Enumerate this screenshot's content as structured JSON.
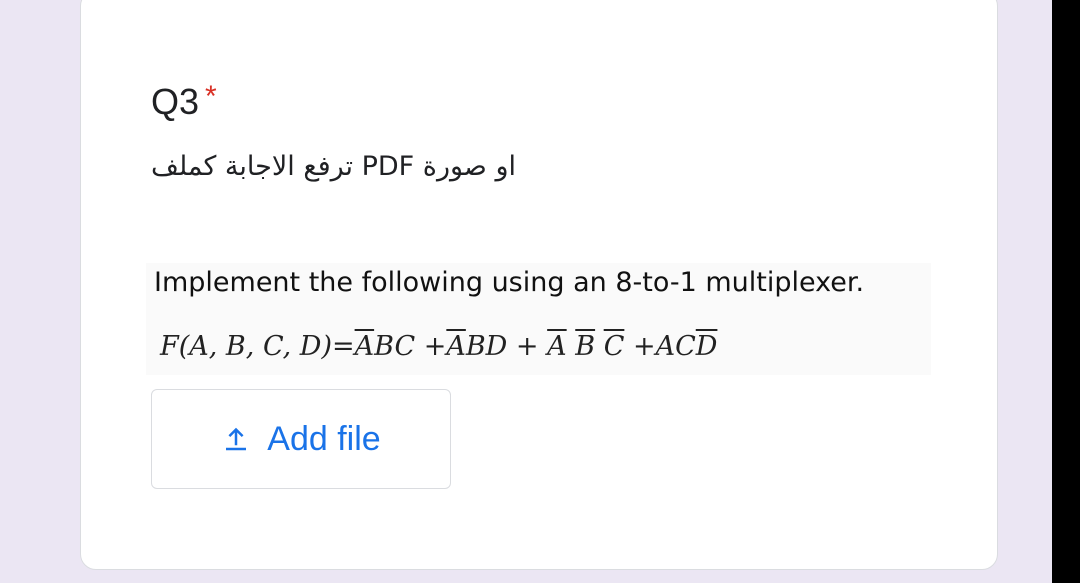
{
  "question": {
    "title": "Q3",
    "required_marker": "*",
    "description": "او صورة PDF ترفع الاجابة كملف"
  },
  "question_image": {
    "instruction": "Implement the following using an 8-to-1 multiplexer.",
    "function_prefix": "F(A, B, C, D)=",
    "term1_bar": "A",
    "term1_rest": "BC",
    "plus1": " +",
    "term2_bar": "A",
    "term2_rest": "BD",
    "plus2": " +",
    "term3_a": "A",
    "term3_b": "B",
    "term3_c": "C",
    "plus3": " +",
    "term4_plain": "AC",
    "term4_bar": "D"
  },
  "upload": {
    "label": "Add file",
    "icon": "upload-icon"
  },
  "colors": {
    "background": "#ebe6f3",
    "card": "#ffffff",
    "required": "#d93025",
    "accent": "#1a73e8",
    "border": "#dadce0"
  }
}
